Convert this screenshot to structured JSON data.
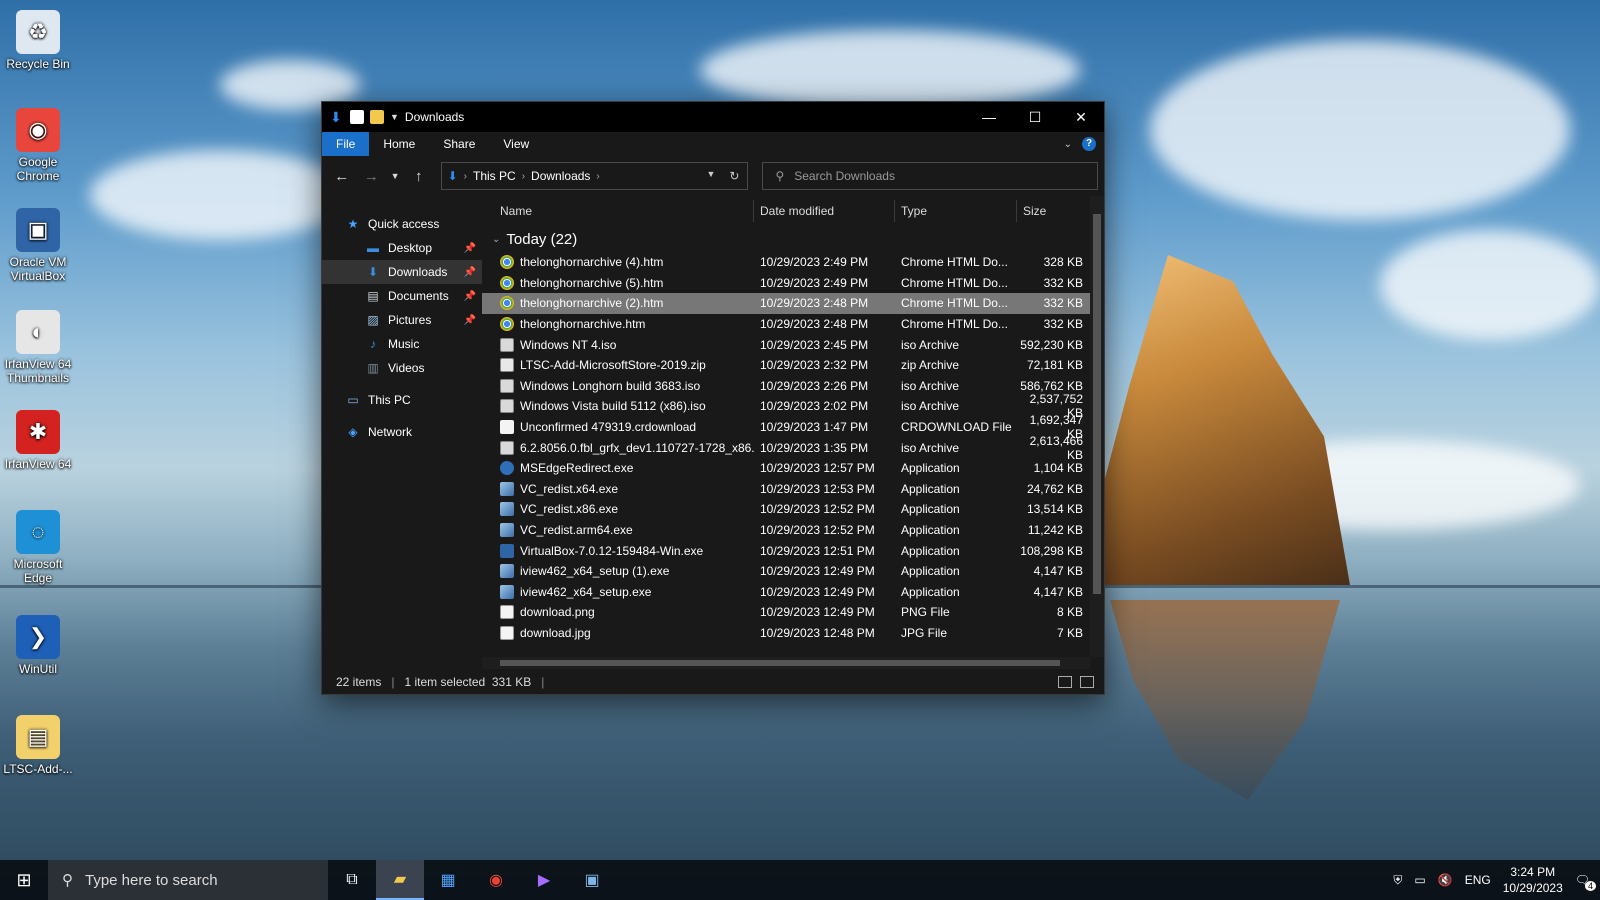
{
  "desktop": {
    "icons": [
      {
        "label": "Recycle Bin",
        "icon": "recycle-bin-icon",
        "color": "#dfe7f1"
      },
      {
        "label": "Google Chrome",
        "icon": "chrome-icon",
        "color": "#e8453c"
      },
      {
        "label": "Oracle VM VirtualBox",
        "icon": "virtualbox-icon",
        "color": "#2f64a7"
      },
      {
        "label": "IrfanView 64 Thumbnails",
        "icon": "irfanview-thumbnails-icon",
        "color": "#e6e6e6"
      },
      {
        "label": "IrfanView 64",
        "icon": "irfanview-icon",
        "color": "#d3221f"
      },
      {
        "label": "Microsoft Edge",
        "icon": "edge-icon",
        "color": "#1e90d6"
      },
      {
        "label": "WinUtil",
        "icon": "powershell-icon",
        "color": "#1e5fb8"
      },
      {
        "label": "LTSC-Add-...",
        "icon": "zip-folder-icon",
        "color": "#f2d16b"
      }
    ]
  },
  "window": {
    "title": "Downloads",
    "ribbon_tabs": [
      "File",
      "Home",
      "Share",
      "View"
    ],
    "address": {
      "segments": [
        "This PC",
        "Downloads"
      ]
    },
    "search_placeholder": "Search Downloads",
    "nav": [
      {
        "label": "Quick access",
        "icon": "star-icon",
        "level": 0,
        "pinned": false
      },
      {
        "label": "Desktop",
        "icon": "desktop-folder-icon",
        "level": 1,
        "pinned": true
      },
      {
        "label": "Downloads",
        "icon": "download-arrow-icon",
        "level": 1,
        "pinned": true,
        "selected": true
      },
      {
        "label": "Documents",
        "icon": "documents-icon",
        "level": 1,
        "pinned": true
      },
      {
        "label": "Pictures",
        "icon": "pictures-icon",
        "level": 1,
        "pinned": true
      },
      {
        "label": "Music",
        "icon": "music-icon",
        "level": 1,
        "pinned": false
      },
      {
        "label": "Videos",
        "icon": "videos-icon",
        "level": 1,
        "pinned": false
      },
      {
        "label": "This PC",
        "icon": "computer-icon",
        "level": 0,
        "pinned": false
      },
      {
        "label": "Network",
        "icon": "network-icon",
        "level": 0,
        "pinned": false
      }
    ],
    "columns": [
      "Name",
      "Date modified",
      "Type",
      "Size"
    ],
    "group_label": "Today (22)",
    "files": [
      {
        "name": "thelonghornarchive (4).htm",
        "date": "10/29/2023 2:49 PM",
        "type": "Chrome HTML Do...",
        "size": "328 KB",
        "icon": "chrome-icon"
      },
      {
        "name": "thelonghornarchive (5).htm",
        "date": "10/29/2023 2:49 PM",
        "type": "Chrome HTML Do...",
        "size": "332 KB",
        "icon": "chrome-icon"
      },
      {
        "name": "thelonghornarchive (2).htm",
        "date": "10/29/2023 2:48 PM",
        "type": "Chrome HTML Do...",
        "size": "332 KB",
        "icon": "chrome-icon",
        "selected": true
      },
      {
        "name": "thelonghornarchive.htm",
        "date": "10/29/2023 2:48 PM",
        "type": "Chrome HTML Do...",
        "size": "332 KB",
        "icon": "chrome-icon"
      },
      {
        "name": "Windows NT 4.iso",
        "date": "10/29/2023 2:45 PM",
        "type": "iso Archive",
        "size": "592,230 KB",
        "icon": "iso-archive-icon"
      },
      {
        "name": "LTSC-Add-MicrosoftStore-2019.zip",
        "date": "10/29/2023 2:32 PM",
        "type": "zip Archive",
        "size": "72,181 KB",
        "icon": "zip-archive-icon"
      },
      {
        "name": "Windows Longhorn build 3683.iso",
        "date": "10/29/2023 2:26 PM",
        "type": "iso Archive",
        "size": "586,762 KB",
        "icon": "iso-archive-icon"
      },
      {
        "name": "Windows Vista build 5112 (x86).iso",
        "date": "10/29/2023 2:02 PM",
        "type": "iso Archive",
        "size": "2,537,752 KB",
        "icon": "iso-archive-icon"
      },
      {
        "name": "Unconfirmed 479319.crdownload",
        "date": "10/29/2023 1:47 PM",
        "type": "CRDOWNLOAD File",
        "size": "1,692,347 KB",
        "icon": "blank-file-icon"
      },
      {
        "name": "6.2.8056.0.fbl_grfx_dev1.110727-1728_x86...",
        "date": "10/29/2023 1:35 PM",
        "type": "iso Archive",
        "size": "2,613,466 KB",
        "icon": "iso-archive-icon"
      },
      {
        "name": "MSEdgeRedirect.exe",
        "date": "10/29/2023 12:57 PM",
        "type": "Application",
        "size": "1,104 KB",
        "icon": "edge-redirect-icon"
      },
      {
        "name": "VC_redist.x64.exe",
        "date": "10/29/2023 12:53 PM",
        "type": "Application",
        "size": "24,762 KB",
        "icon": "installer-icon"
      },
      {
        "name": "VC_redist.x86.exe",
        "date": "10/29/2023 12:52 PM",
        "type": "Application",
        "size": "13,514 KB",
        "icon": "installer-icon"
      },
      {
        "name": "VC_redist.arm64.exe",
        "date": "10/29/2023 12:52 PM",
        "type": "Application",
        "size": "11,242 KB",
        "icon": "installer-icon"
      },
      {
        "name": "VirtualBox-7.0.12-159484-Win.exe",
        "date": "10/29/2023 12:51 PM",
        "type": "Application",
        "size": "108,298 KB",
        "icon": "virtualbox-icon"
      },
      {
        "name": "iview462_x64_setup (1).exe",
        "date": "10/29/2023 12:49 PM",
        "type": "Application",
        "size": "4,147 KB",
        "icon": "installer-icon"
      },
      {
        "name": "iview462_x64_setup.exe",
        "date": "10/29/2023 12:49 PM",
        "type": "Application",
        "size": "4,147 KB",
        "icon": "installer-icon"
      },
      {
        "name": "download.png",
        "date": "10/29/2023 12:49 PM",
        "type": "PNG File",
        "size": "8 KB",
        "icon": "image-file-icon"
      },
      {
        "name": "download.jpg",
        "date": "10/29/2023 12:48 PM",
        "type": "JPG File",
        "size": "7 KB",
        "icon": "image-file-icon"
      }
    ],
    "status": {
      "items": "22 items",
      "selection": "1 item selected  331 KB"
    }
  },
  "taskbar": {
    "search_placeholder": "Type here to search",
    "apps": [
      {
        "name": "task-view",
        "icon": "task-view-icon"
      },
      {
        "name": "file-explorer",
        "icon": "folder-icon",
        "active": true
      },
      {
        "name": "microsoft-store",
        "icon": "store-icon"
      },
      {
        "name": "chrome",
        "icon": "chrome-icon"
      },
      {
        "name": "clipchamp",
        "icon": "clipchamp-icon"
      },
      {
        "name": "remote-desktop",
        "icon": "remote-desktop-icon"
      }
    ],
    "language": "ENG",
    "time": "3:24 PM",
    "date": "10/29/2023",
    "notification_count": "4"
  }
}
